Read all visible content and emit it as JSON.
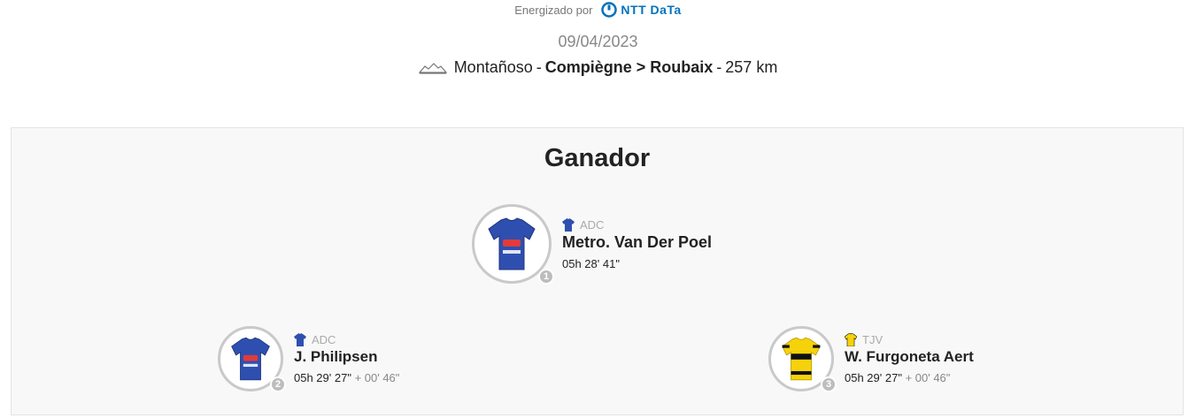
{
  "sponsor": {
    "label": "Energizado por",
    "logo_text": "NTT DaTa",
    "logo_color": "#0072bc"
  },
  "stage": {
    "date": "09/04/2023",
    "terrain": "Montañoso",
    "route": "Compiègne > Roubaix",
    "distance": "257 km",
    "sep1": "-",
    "sep2": "-"
  },
  "podium": {
    "title": "Ganador",
    "riders": [
      {
        "position": "1",
        "team": "ADC",
        "name": "Metro. Van Der Poel",
        "time": "05h 28' 41\"",
        "gap": "",
        "jersey": "blue"
      },
      {
        "position": "2",
        "team": "ADC",
        "name": "J. Philipsen",
        "time": "05h 29' 27\"",
        "gap": "+ 00' 46\"",
        "jersey": "blue"
      },
      {
        "position": "3",
        "team": "TJV",
        "name": "W. Furgoneta Aert",
        "time": "05h 29' 27\"",
        "gap": "+ 00' 46\"",
        "jersey": "yellow"
      }
    ]
  },
  "colors": {
    "jersey_blue": "#2e4fb0",
    "jersey_yellow": "#f5d20a",
    "badge": "#bdbdbd",
    "panel_bg": "#f8f8f8"
  }
}
